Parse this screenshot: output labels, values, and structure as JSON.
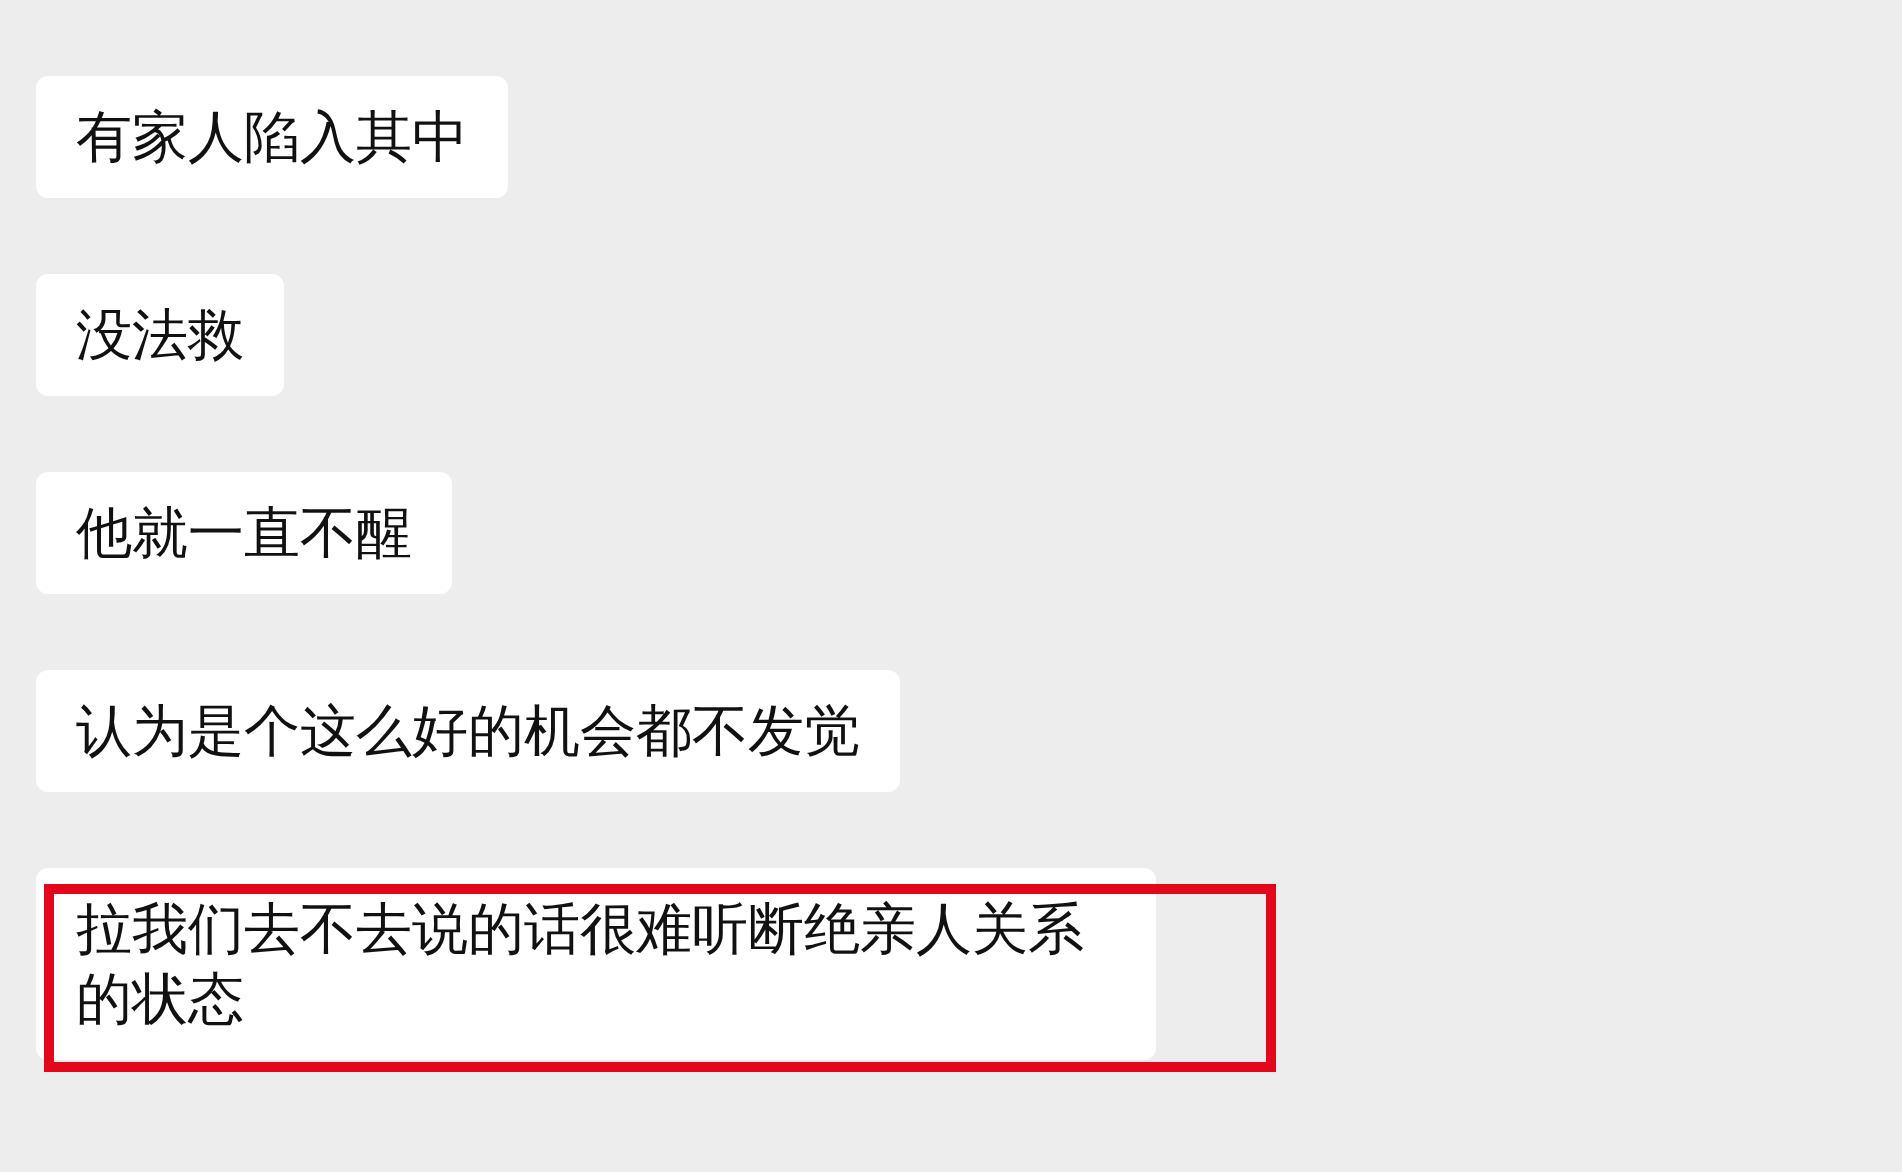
{
  "messages": [
    {
      "text": "有家人陷入其中",
      "highlighted": false
    },
    {
      "text": "没法救",
      "highlighted": false
    },
    {
      "text": "他就一直不醒",
      "highlighted": false
    },
    {
      "text": "认为是个这么好的机会都不发觉",
      "highlighted": false
    },
    {
      "text": "拉我们去不去说的话很难听断绝亲人关系的状态",
      "highlighted": true
    }
  ]
}
